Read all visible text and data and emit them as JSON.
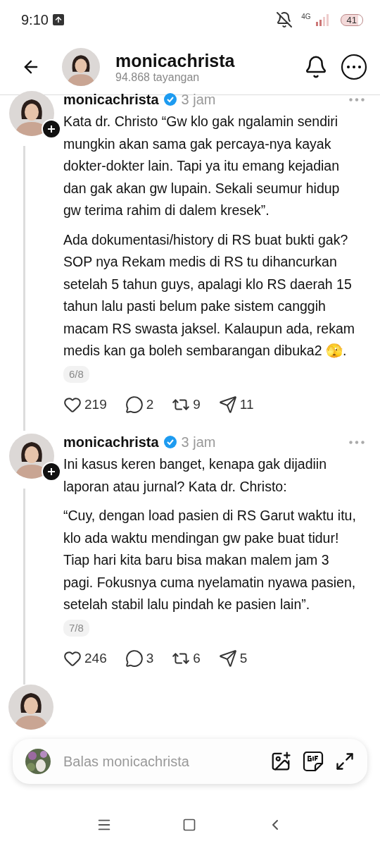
{
  "status_bar": {
    "time": "9:10",
    "network": "4G",
    "battery": "41"
  },
  "header": {
    "title": "monicachrista",
    "subtitle": "94.868 tayangan"
  },
  "posts": [
    {
      "author": "monicachrista",
      "verified": true,
      "time": "3 jam",
      "paragraphs": [
        "Kata dr. Christo “Gw klo gak ngalamin sendiri mungkin akan sama gak percaya-nya kayak dokter-dokter lain. Tapi ya itu emang kejadian dan gak akan gw lupain. Sekali seumur hidup gw terima rahim di dalem kresek”.",
        "Ada dokumentasi/history di RS buat bukti gak? SOP nya Rekam medis di RS tu dihancurkan setelah 5 tahun guys, apalagi klo RS daerah 15 tahun lalu pasti belum pake sistem canggih macam RS swasta jaksel. Kalaupun ada, rekam medis kan ga boleh sembarangan dibuka2 🫣."
      ],
      "counter": "6/8",
      "likes": "219",
      "replies": "2",
      "reposts": "9",
      "shares": "11"
    },
    {
      "author": "monicachrista",
      "verified": true,
      "time": "3 jam",
      "paragraphs": [
        "Ini kasus keren banget, kenapa gak dijadiin laporan atau jurnal? Kata dr. Christo:",
        "“Cuy, dengan load pasien di RS Garut waktu itu, klo ada waktu mendingan gw pake buat tidur! Tiap hari kita baru bisa makan malem jam 3 pagi. Fokusnya cuma nyelamatin nyawa pasien, setelah stabil lalu pindah ke pasien lain”."
      ],
      "counter": "7/8",
      "likes": "246",
      "replies": "3",
      "reposts": "6",
      "shares": "5"
    }
  ],
  "reply_bar": {
    "placeholder": "Balas monicachrista"
  }
}
